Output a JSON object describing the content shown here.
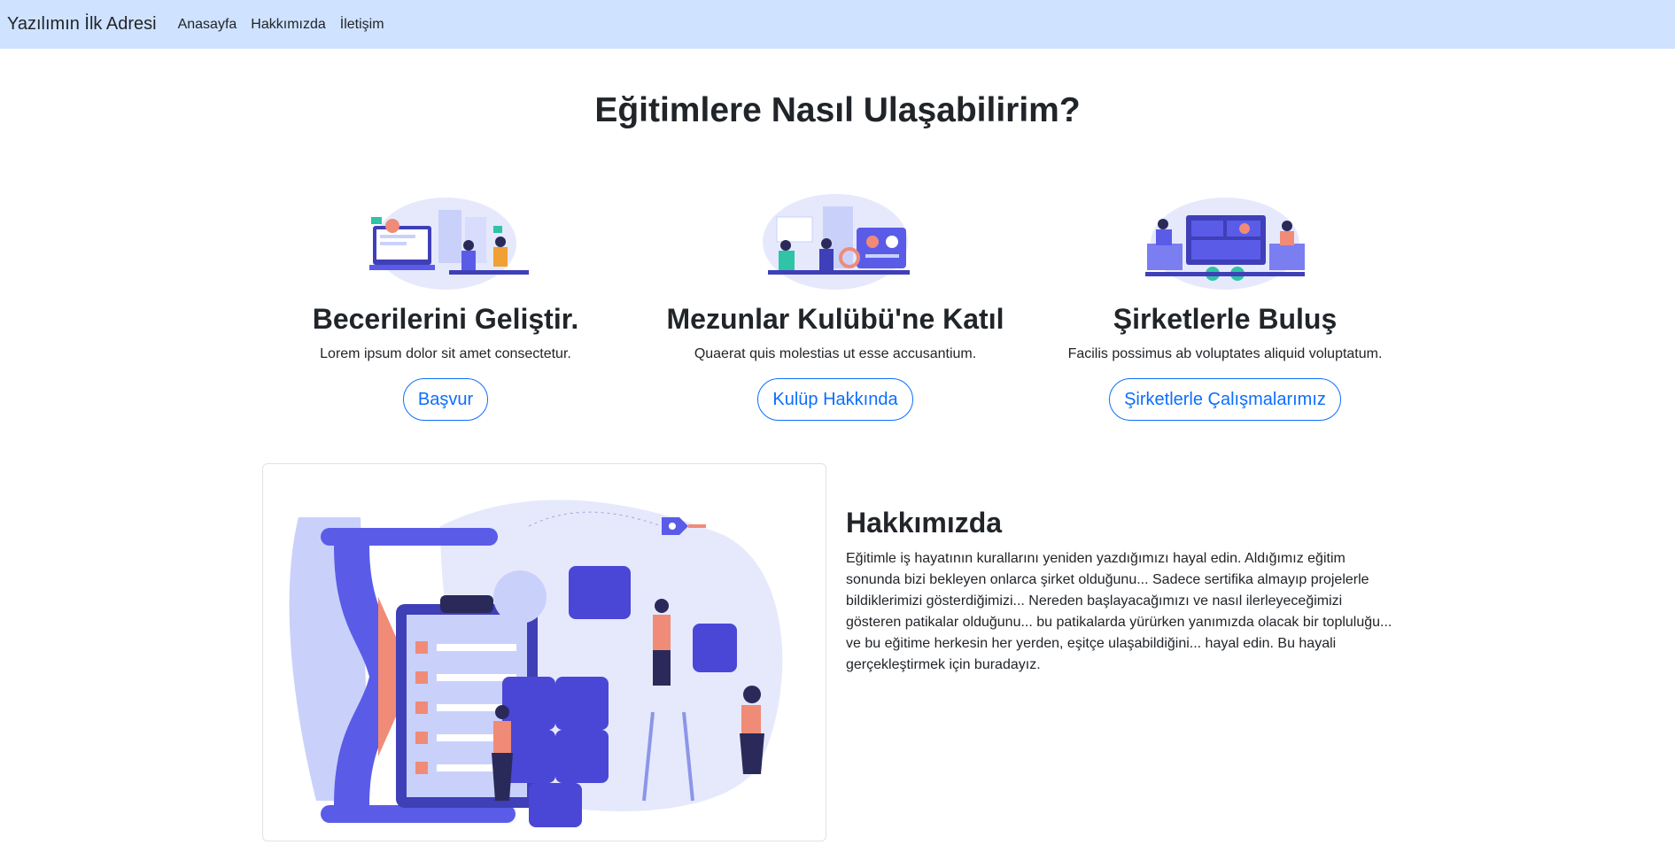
{
  "navbar": {
    "brand": "Yazılımın İlk Adresi",
    "links": [
      "Anasayfa",
      "Hakkımızda",
      "İletişim"
    ]
  },
  "page": {
    "title": "Eğitimlere Nasıl Ulaşabilirim?"
  },
  "features": [
    {
      "title": "Becerilerini Geliştir.",
      "text": "Lorem ipsum dolor sit amet consectetur.",
      "button": "Başvur"
    },
    {
      "title": "Mezunlar Kulübü'ne Katıl",
      "text": "Quaerat quis molestias ut esse accusantium.",
      "button": "Kulüp Hakkında"
    },
    {
      "title": "Şirketlerle Buluş",
      "text": "Facilis possimus ab voluptates aliquid voluptatum.",
      "button": "Şirketlerle Çalışmalarımız"
    }
  ],
  "about": {
    "title": "Hakkımızda",
    "text": "Eğitimle iş hayatının kurallarını yeniden yazdığımızı hayal edin. Aldığımız eğitim sonunda bizi bekleyen onlarca şirket olduğunu... Sadece sertifika almayıp projelerle bildiklerimizi gösterdiğimizi... Nereden başlayacağımızı ve nasıl ilerleyeceğimizi gösteren patikalar olduğunu... bu patikalarda yürürken yanımızda olacak bir topluluğu... ve bu eğitime herkesin her yerden, eşitçe ulaşabildiğini... hayal edin. Bu hayali gerçekleştirmek için buradayız."
  },
  "colors": {
    "navbar_bg": "#cfe2ff",
    "accent": "#0d6efd",
    "illustration_primary": "#5a5ce8",
    "illustration_light": "#c9d1fb",
    "illustration_coral": "#f08b78"
  },
  "icons": {
    "feature_1": "people-coding-illustration",
    "feature_2": "people-networking-illustration",
    "feature_3": "people-dashboard-illustration",
    "about": "hourglass-puzzle-illustration"
  }
}
